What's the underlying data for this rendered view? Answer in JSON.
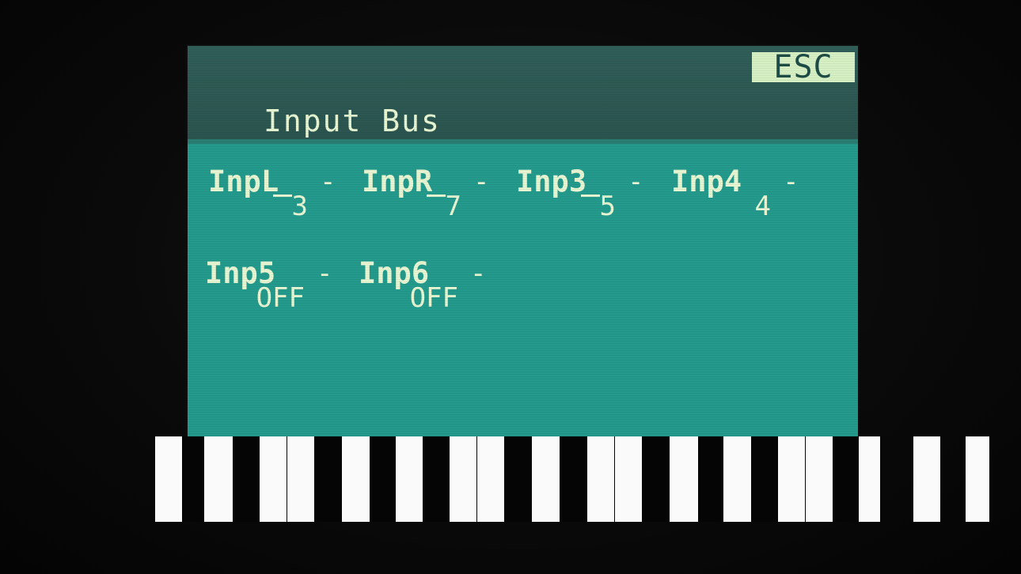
{
  "header": {
    "title": "Input Bus",
    "esc_label": "ESC"
  },
  "params": [
    {
      "label": "InpL",
      "value": "3"
    },
    {
      "label": "InpR",
      "value": "7"
    },
    {
      "label": "Inp3",
      "value": "5"
    },
    {
      "label": "Inp4",
      "value": "4"
    },
    {
      "label": "Inp5",
      "value": "OFF"
    },
    {
      "label": "Inp6",
      "value": "OFF"
    }
  ],
  "dash": "-",
  "keyboard": {
    "white_key_count": 18
  },
  "colors": {
    "screen": "#239a8c",
    "header": "#2b544f",
    "text": "#e7f5d2",
    "esc_background": "#d6f0c4"
  }
}
